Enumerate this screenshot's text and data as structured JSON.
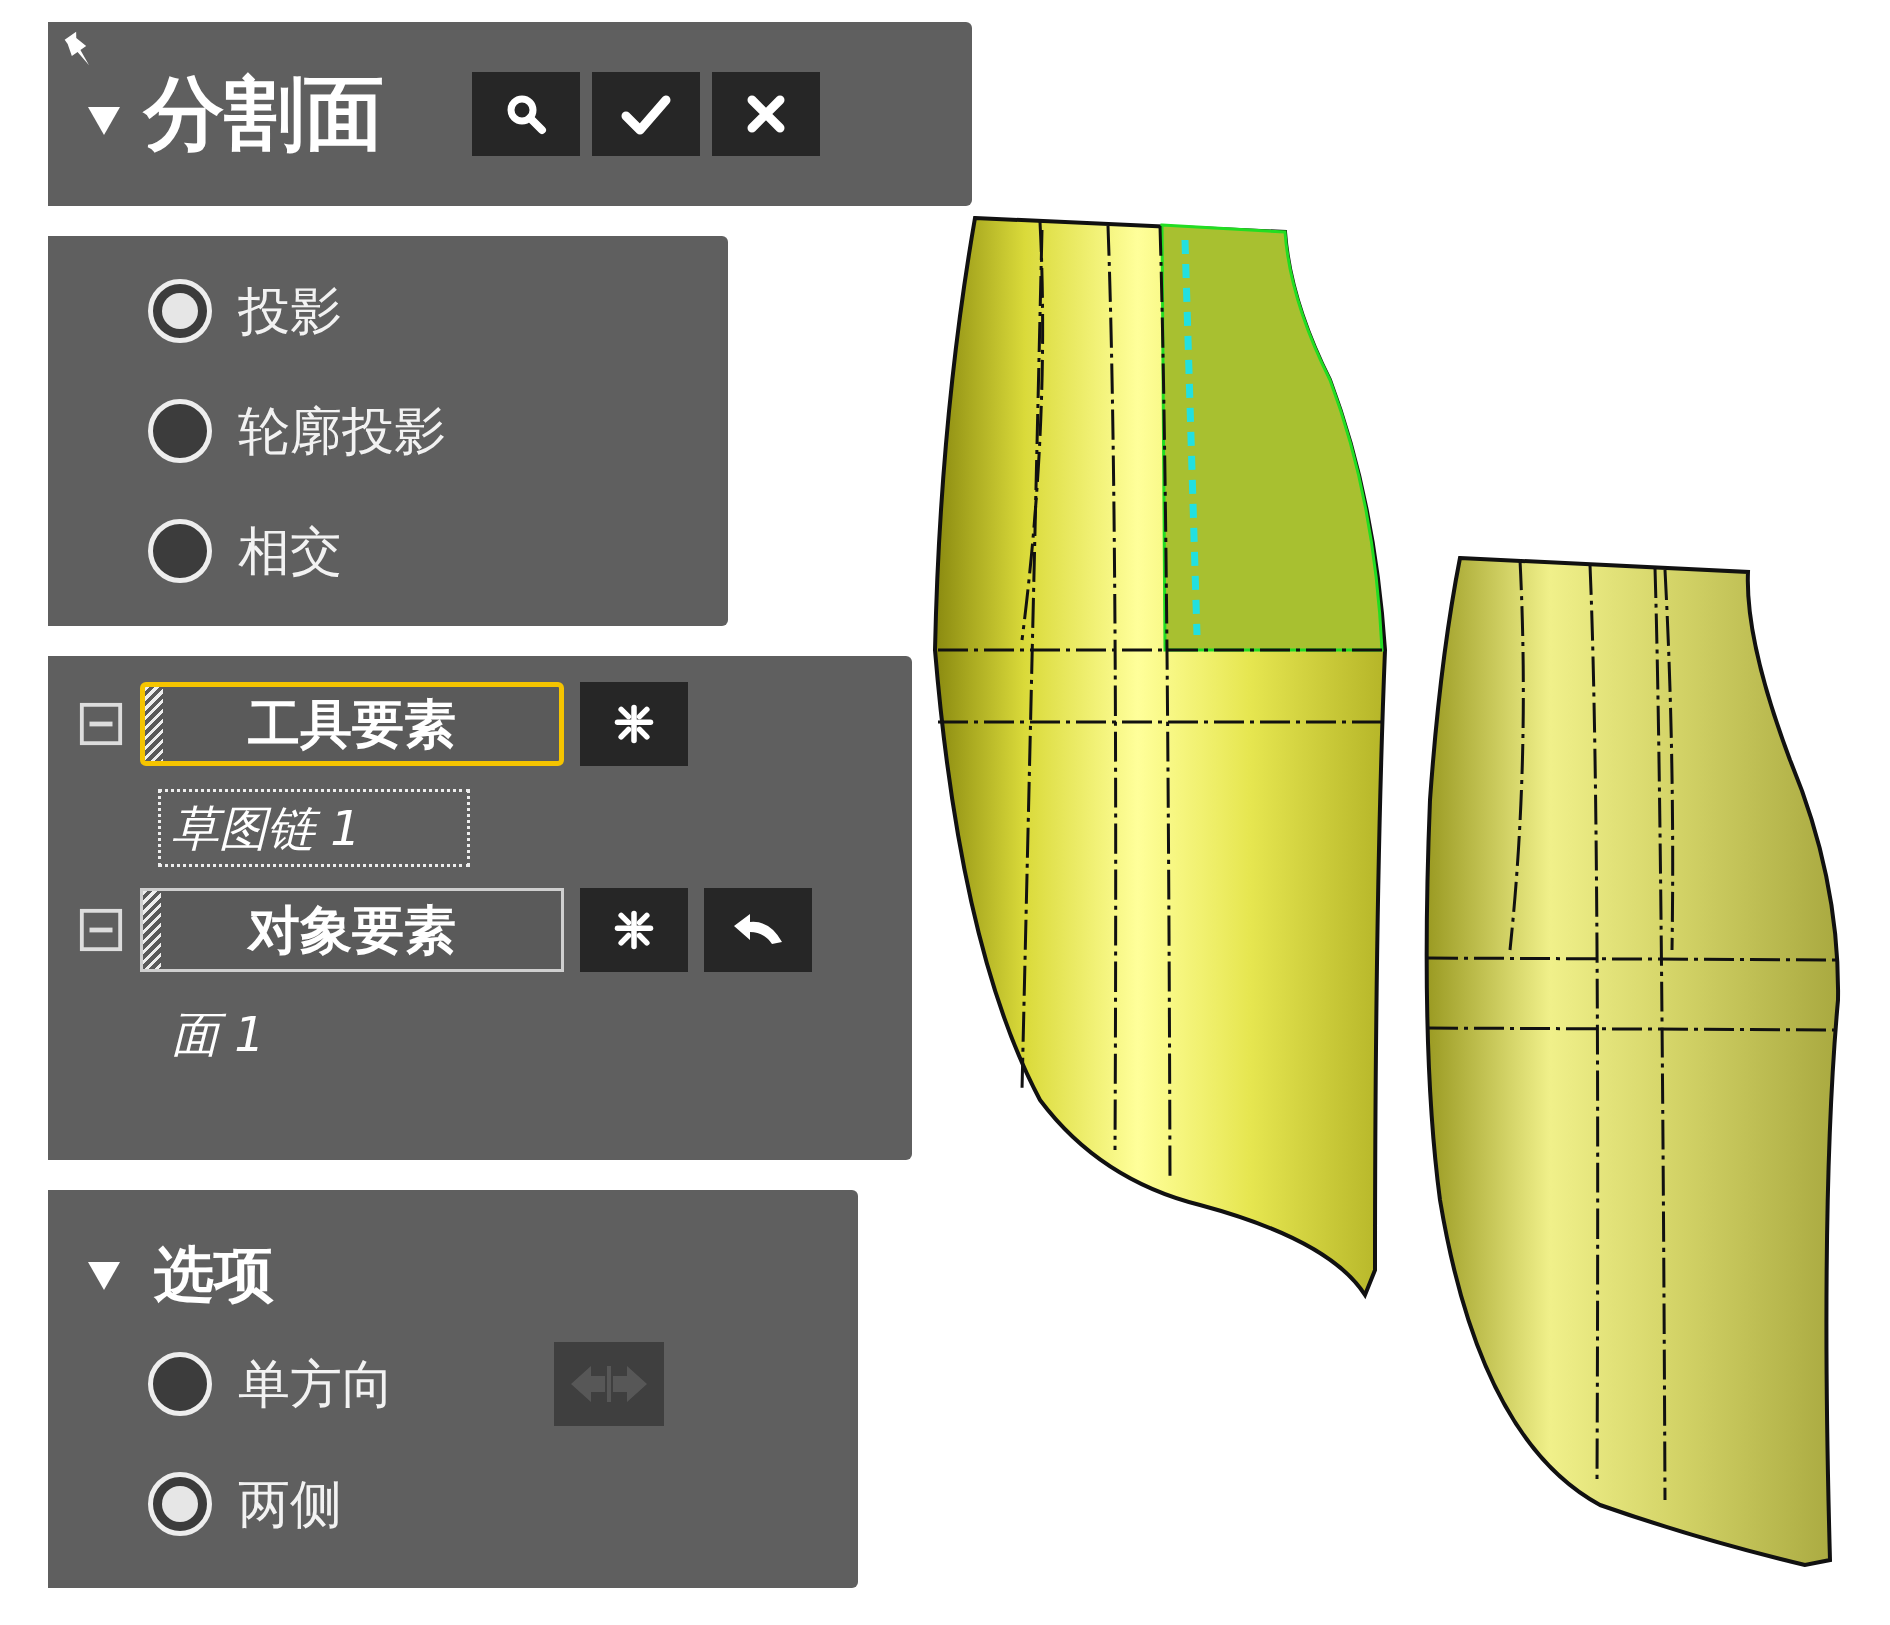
{
  "panel": {
    "title": "分割面",
    "expanded": true,
    "pinned": true,
    "header_buttons": [
      {
        "kind": "preview"
      },
      {
        "kind": "ok"
      },
      {
        "kind": "cancel"
      }
    ]
  },
  "split_methods": [
    {
      "label": "投影",
      "selected": true
    },
    {
      "label": "轮廓投影",
      "selected": false
    },
    {
      "label": "相交",
      "selected": false
    }
  ],
  "selectors": [
    {
      "label": "工具要素",
      "active": true,
      "expanded": true,
      "item": "草图链 1",
      "item_focused": true,
      "buttons": [
        {
          "kind": "options"
        }
      ]
    },
    {
      "label": "对象要素",
      "active": false,
      "expanded": true,
      "item": "面 1",
      "item_focused": false,
      "buttons": [
        {
          "kind": "options"
        },
        {
          "kind": "undo"
        }
      ]
    }
  ],
  "options": {
    "title": "选项",
    "expanded": true,
    "directions": [
      {
        "label": "单方向",
        "selected": false
      },
      {
        "label": "两侧",
        "selected": true
      }
    ],
    "flip_disabled": true
  }
}
